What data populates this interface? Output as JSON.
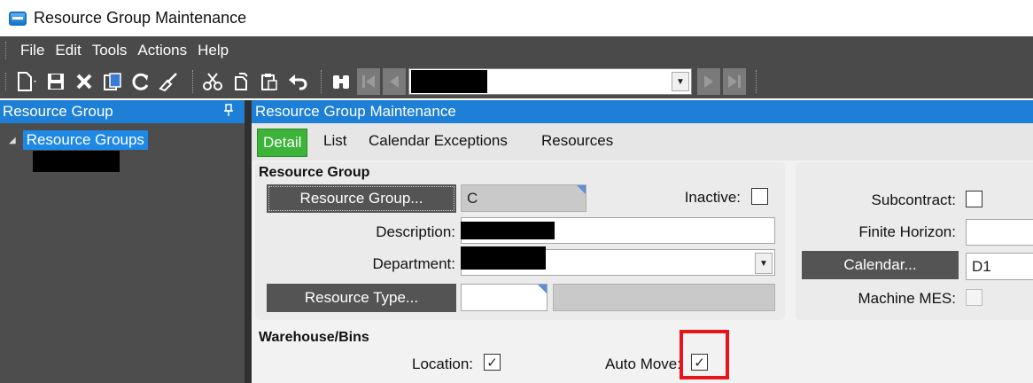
{
  "window": {
    "title": "Resource Group Maintenance"
  },
  "menu": {
    "items": [
      "File",
      "Edit",
      "Tools",
      "Actions",
      "Help"
    ]
  },
  "toolbar": {
    "icons": [
      "new-icon",
      "save-icon",
      "delete-icon",
      "copy-icon",
      "refresh-icon",
      "clear-icon",
      "cut-icon",
      "paste-icon",
      "clipboard-icon",
      "undo-icon",
      "binoculars-icon",
      "first-record-icon",
      "previous-record-icon",
      "next-record-icon",
      "last-record-icon"
    ]
  },
  "left_panel": {
    "title": "Resource Group",
    "tree_root": "Resource Groups"
  },
  "main": {
    "title": "Resource Group Maintenance",
    "tabs": {
      "detail": "Detail",
      "list": "List",
      "calendar_exceptions": "Calendar Exceptions",
      "resources": "Resources"
    },
    "resource_group_section": {
      "title": "Resource Group",
      "resource_group_button": "Resource Group...",
      "resource_group_value": "C",
      "inactive_label": "Inactive:",
      "description_label": "Description:",
      "department_label": "Department:",
      "resource_type_button": "Resource Type..."
    },
    "right_section": {
      "subcontract_label": "Subcontract:",
      "finite_horizon_label": "Finite Horizon:",
      "calendar_button": "Calendar...",
      "calendar_value": "D1",
      "machine_mes_label": "Machine MES:"
    },
    "warehouse_section": {
      "title": "Warehouse/Bins",
      "location_label": "Location:",
      "location_checked": true,
      "auto_move_label": "Auto Move:",
      "auto_move_checked": true
    }
  },
  "glyphs": {
    "check": "✓",
    "dropdown": "▼"
  },
  "colors": {
    "accent": "#1e7fd6",
    "active_tab": "#3cb339",
    "highlight": "#e8141a"
  }
}
